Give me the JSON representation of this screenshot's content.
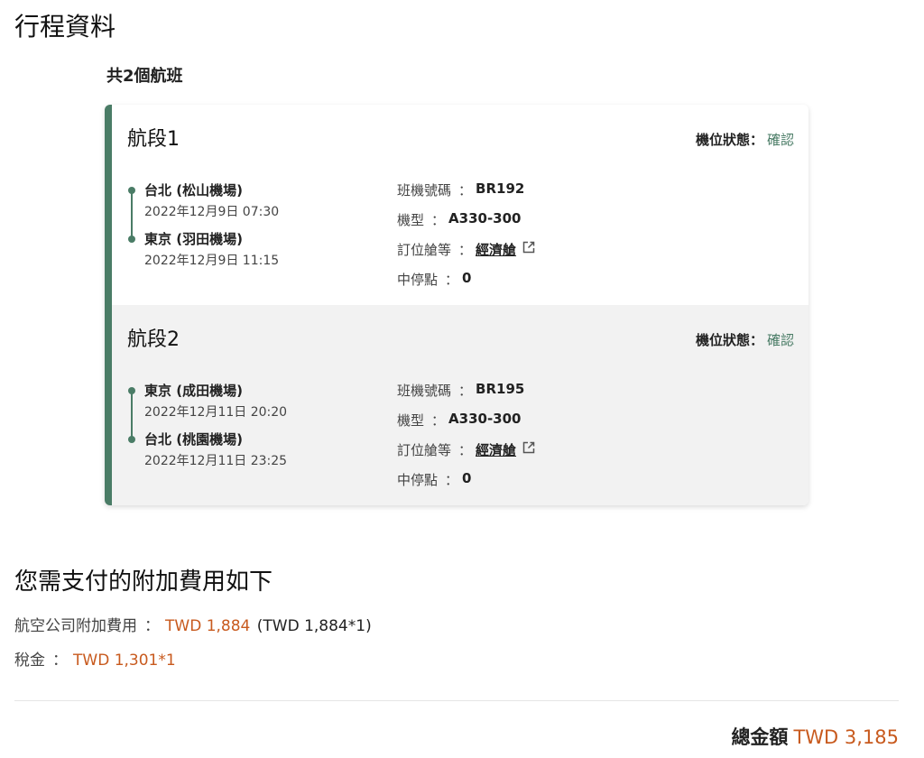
{
  "page": {
    "title": "行程資料",
    "flight_count": "共2個航班"
  },
  "segments": [
    {
      "title": "航段1",
      "status_label": "機位狀態：",
      "status_value": "確認",
      "from_airport": "台北 (松山機場)",
      "from_time": "2022年12月9日 07:30",
      "to_airport": "東京 (羽田機場)",
      "to_time": "2022年12月9日 11:15",
      "flight_label": "班機號碼",
      "flight_no": "BR192",
      "aircraft_label": "機型",
      "aircraft": "A330-300",
      "cabin_label": "訂位艙等",
      "cabin": "經濟艙",
      "stops_label": "中停點",
      "stops": "0"
    },
    {
      "title": "航段2",
      "status_label": "機位狀態：",
      "status_value": "確認",
      "from_airport": "東京 (成田機場)",
      "from_time": "2022年12月11日 20:20",
      "to_airport": "台北 (桃園機場)",
      "to_time": "2022年12月11日 23:25",
      "flight_label": "班機號碼",
      "flight_no": "BR195",
      "aircraft_label": "機型",
      "aircraft": "A330-300",
      "cabin_label": "訂位艙等",
      "cabin": "經濟艙",
      "stops_label": "中停點",
      "stops": "0"
    }
  ],
  "fees": {
    "title": "您需支付的附加費用如下",
    "airline_label": "航空公司附加費用",
    "airline_amount": "TWD 1,884",
    "airline_detail": "(TWD 1,884*1)",
    "tax_label": "稅金",
    "tax_amount": "TWD 1,301*1",
    "separator": "："
  },
  "total": {
    "label": "總金額",
    "value": "TWD 3,185"
  },
  "colors": {
    "accent": "#4a7c66",
    "price": "#c85a1e"
  },
  "icons": {
    "cabin_link": "external-link-icon"
  }
}
